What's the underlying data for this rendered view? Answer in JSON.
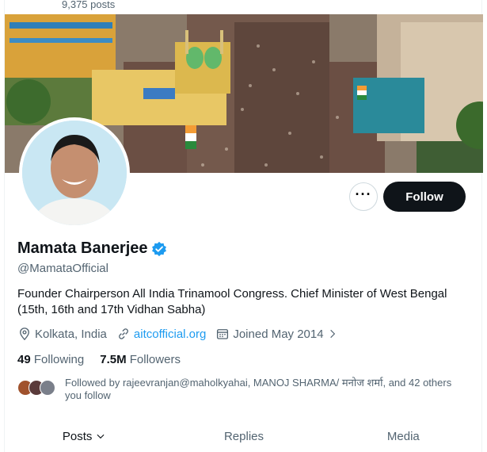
{
  "header": {
    "post_count": "9,375 posts",
    "right_partial": "…"
  },
  "profile": {
    "name": "Mamata Banerjee",
    "handle": "@MamataOfficial",
    "bio": "Founder Chairperson All India Trinamool Congress. Chief Minister of West Bengal (15th, 16th and 17th Vidhan Sabha)",
    "location": "Kolkata, India",
    "website": "aitcofficial.org",
    "joined": "Joined May 2014",
    "following_count": "49",
    "following_label": "Following",
    "followers_count": "7.5M",
    "followers_label": "Followers",
    "followed_by": "Followed by rajeevranjan@maholkyahai, MANOJ SHARMA/ मनोज शर्मा, and 42 others you follow"
  },
  "actions": {
    "more_label": "···",
    "follow_label": "Follow"
  },
  "tabs": [
    {
      "label": "Posts"
    },
    {
      "label": "Replies"
    },
    {
      "label": "Media"
    }
  ],
  "colors": {
    "accent": "#1d9bf0",
    "primary_button": "#0f1419",
    "muted_text": "#536471"
  }
}
